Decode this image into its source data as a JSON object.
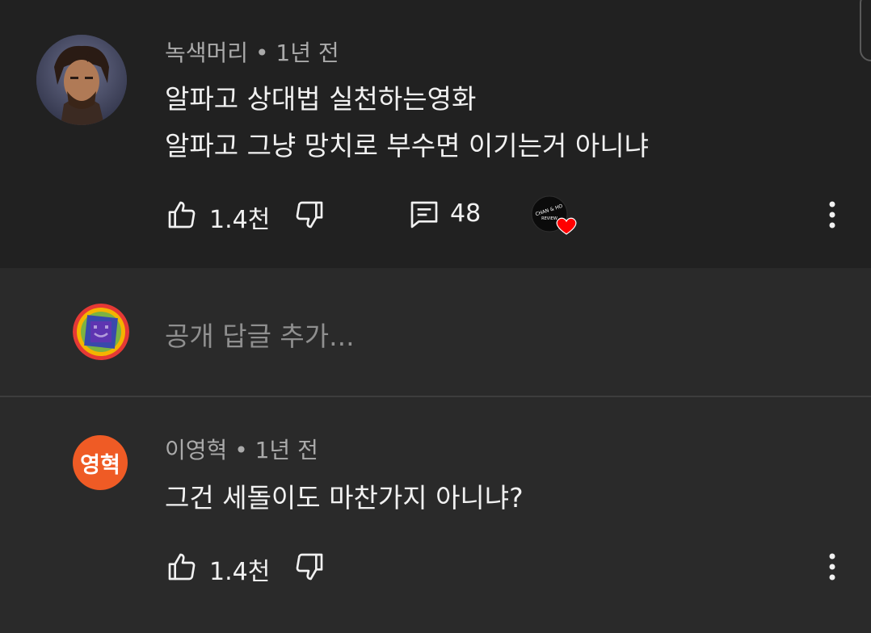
{
  "comment": {
    "author": "녹색머리",
    "time": "1년 전",
    "lines": [
      "알파고 상대법 실천하는영화",
      "알파고 그냥 망치로 부수면 이기는거 아니냐"
    ],
    "like_count": "1.4천",
    "reply_count": "48",
    "creator_heart_badge_text": "CHAN & HO REVIEW"
  },
  "reply_box": {
    "placeholder": "공개 답글 추가..."
  },
  "reply": {
    "author": "이영혁",
    "time": "1년 전",
    "avatar_initials": "영혁",
    "text": "그건 세돌이도 마찬가지 아니냐?",
    "like_count": "1.4천"
  },
  "icons": {
    "like": "thumbs-up-icon",
    "dislike": "thumbs-down-icon",
    "reply": "comment-icon",
    "more": "more-vert-icon",
    "heart": "heart-icon"
  },
  "colors": {
    "background": "#212121",
    "reply_area": "#2a2a2a",
    "secondary_text": "#aaaaaa",
    "avatar_orange": "#ef5b25",
    "heart_red": "#ff0000"
  }
}
